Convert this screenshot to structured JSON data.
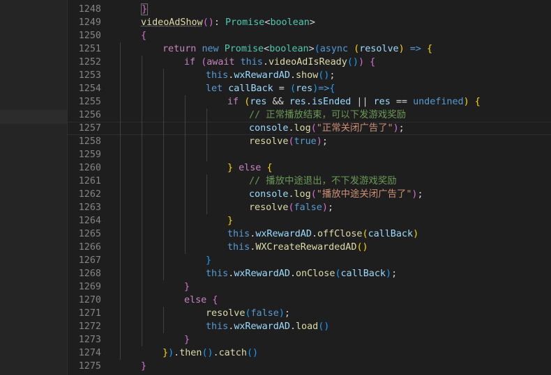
{
  "editor": {
    "language": "javascript",
    "current_line": 1257,
    "lines": [
      {
        "n": "1248",
        "indent": 0,
        "t": [
          [
            "}",
            "p"
          ]
        ],
        "bm": true
      },
      {
        "n": "1249",
        "indent": 0,
        "t": [
          [
            "videoAdShow",
            "f"
          ],
          [
            "()",
            "p"
          ],
          [
            ": ",
            "w"
          ],
          [
            "Promise",
            "t"
          ],
          [
            "<",
            "w"
          ],
          [
            "boolean",
            "t"
          ],
          [
            ">",
            "w"
          ]
        ],
        "fold": true
      },
      {
        "n": "1250",
        "indent": 0,
        "t": [
          [
            "{",
            "p"
          ]
        ]
      },
      {
        "n": "1251",
        "indent": 1,
        "t": [
          [
            "return ",
            "k"
          ],
          [
            "new ",
            "b"
          ],
          [
            "Promise",
            "t"
          ],
          [
            "<",
            "w"
          ],
          [
            "boolean",
            "t"
          ],
          [
            ">",
            "w"
          ],
          [
            "(",
            "q"
          ],
          [
            "async ",
            "b"
          ],
          [
            "(",
            "y"
          ],
          [
            "resolve",
            "v"
          ],
          [
            ")",
            "y"
          ],
          [
            " => ",
            "b"
          ],
          [
            "{",
            "y"
          ]
        ]
      },
      {
        "n": "1252",
        "indent": 2,
        "t": [
          [
            "if ",
            "k"
          ],
          [
            "(",
            "p"
          ],
          [
            "await ",
            "k"
          ],
          [
            "this",
            "b"
          ],
          [
            ".",
            "w"
          ],
          [
            "videoAdIsReady",
            "f"
          ],
          [
            "()",
            "q"
          ],
          [
            ")",
            "p"
          ],
          [
            " ",
            "w"
          ],
          [
            "{",
            "p"
          ]
        ]
      },
      {
        "n": "1253",
        "indent": 3,
        "t": [
          [
            "this",
            "b"
          ],
          [
            ".",
            "w"
          ],
          [
            "wxRewardAD",
            "v"
          ],
          [
            ".",
            "w"
          ],
          [
            "show",
            "f"
          ],
          [
            "()",
            "q"
          ],
          [
            ";",
            "w"
          ]
        ]
      },
      {
        "n": "1254",
        "indent": 3,
        "t": [
          [
            "let ",
            "b"
          ],
          [
            "callBack",
            "v"
          ],
          [
            " = ",
            "w"
          ],
          [
            "(",
            "q"
          ],
          [
            "res",
            "v"
          ],
          [
            ")",
            "q"
          ],
          [
            "=>",
            "b"
          ],
          [
            "{",
            "q"
          ]
        ]
      },
      {
        "n": "1255",
        "indent": 4,
        "t": [
          [
            "if ",
            "k"
          ],
          [
            "(",
            "y"
          ],
          [
            "res",
            "v"
          ],
          [
            " && ",
            "w"
          ],
          [
            "res",
            "v"
          ],
          [
            ".",
            "w"
          ],
          [
            "isEnded",
            "v"
          ],
          [
            " || ",
            "w"
          ],
          [
            "res",
            "v"
          ],
          [
            " == ",
            "w"
          ],
          [
            "undefined",
            "b"
          ],
          [
            ")",
            "y"
          ],
          [
            " ",
            "w"
          ],
          [
            "{",
            "y"
          ]
        ]
      },
      {
        "n": "1256",
        "indent": 5,
        "t": [
          [
            "// 正常播放结束，可以下发游戏奖励",
            "c"
          ]
        ]
      },
      {
        "n": "1257",
        "indent": 5,
        "t": [
          [
            "console",
            "v"
          ],
          [
            ".",
            "w"
          ],
          [
            "log",
            "f"
          ],
          [
            "(",
            "p"
          ],
          [
            "\"正常关闭广告了\"",
            "s"
          ],
          [
            ")",
            "p"
          ],
          [
            ";",
            "w"
          ]
        ]
      },
      {
        "n": "1258",
        "indent": 5,
        "t": [
          [
            "resolve",
            "f"
          ],
          [
            "(",
            "p"
          ],
          [
            "true",
            "b"
          ],
          [
            ")",
            "p"
          ],
          [
            ";",
            "w"
          ]
        ]
      },
      {
        "n": "1259",
        "indent": 5,
        "t": []
      },
      {
        "n": "1260",
        "indent": 4,
        "t": [
          [
            "}",
            "y"
          ],
          [
            " else ",
            "k"
          ],
          [
            "{",
            "y"
          ]
        ]
      },
      {
        "n": "1261",
        "indent": 5,
        "t": [
          [
            "// 播放中途退出，不下发游戏奖励",
            "c"
          ]
        ]
      },
      {
        "n": "1262",
        "indent": 5,
        "t": [
          [
            "console",
            "v"
          ],
          [
            ".",
            "w"
          ],
          [
            "log",
            "f"
          ],
          [
            "(",
            "p"
          ],
          [
            "\"播放中途关闭广告了\"",
            "s"
          ],
          [
            ")",
            "p"
          ],
          [
            ";",
            "w"
          ]
        ]
      },
      {
        "n": "1263",
        "indent": 5,
        "t": [
          [
            "resolve",
            "f"
          ],
          [
            "(",
            "p"
          ],
          [
            "false",
            "b"
          ],
          [
            ")",
            "p"
          ],
          [
            ";",
            "w"
          ]
        ]
      },
      {
        "n": "1264",
        "indent": 4,
        "t": [
          [
            "}",
            "y"
          ]
        ]
      },
      {
        "n": "1265",
        "indent": 4,
        "t": [
          [
            "this",
            "b"
          ],
          [
            ".",
            "w"
          ],
          [
            "wxRewardAD",
            "v"
          ],
          [
            ".",
            "w"
          ],
          [
            "offClose",
            "f"
          ],
          [
            "(",
            "y"
          ],
          [
            "callBack",
            "v"
          ],
          [
            ")",
            "y"
          ]
        ]
      },
      {
        "n": "1266",
        "indent": 4,
        "t": [
          [
            "this",
            "b"
          ],
          [
            ".",
            "w"
          ],
          [
            "WXCreateRewardedAD",
            "f"
          ],
          [
            "()",
            "y"
          ]
        ]
      },
      {
        "n": "1267",
        "indent": 3,
        "t": [
          [
            "}",
            "q"
          ]
        ]
      },
      {
        "n": "1268",
        "indent": 3,
        "t": [
          [
            "this",
            "b"
          ],
          [
            ".",
            "w"
          ],
          [
            "wxRewardAD",
            "v"
          ],
          [
            ".",
            "w"
          ],
          [
            "onClose",
            "f"
          ],
          [
            "(",
            "q"
          ],
          [
            "callBack",
            "v"
          ],
          [
            ")",
            "q"
          ],
          [
            ";",
            "w"
          ]
        ]
      },
      {
        "n": "1269",
        "indent": 2,
        "t": [
          [
            "}",
            "p"
          ]
        ]
      },
      {
        "n": "1270",
        "indent": 2,
        "t": [
          [
            "else ",
            "k"
          ],
          [
            "{",
            "p"
          ]
        ]
      },
      {
        "n": "1271",
        "indent": 3,
        "t": [
          [
            "resolve",
            "f"
          ],
          [
            "(",
            "q"
          ],
          [
            "false",
            "b"
          ],
          [
            ")",
            "q"
          ],
          [
            ";",
            "w"
          ]
        ]
      },
      {
        "n": "1272",
        "indent": 3,
        "t": [
          [
            "this",
            "b"
          ],
          [
            ".",
            "w"
          ],
          [
            "wxRewardAD",
            "v"
          ],
          [
            ".",
            "w"
          ],
          [
            "load",
            "f"
          ],
          [
            "()",
            "q"
          ]
        ]
      },
      {
        "n": "1273",
        "indent": 2,
        "t": [
          [
            "}",
            "p"
          ]
        ]
      },
      {
        "n": "1274",
        "indent": 1,
        "t": [
          [
            "}",
            "y"
          ],
          [
            ")",
            "q"
          ],
          [
            ".",
            "w"
          ],
          [
            "then",
            "f"
          ],
          [
            "()",
            "q"
          ],
          [
            ".",
            "w"
          ],
          [
            "catch",
            "f"
          ],
          [
            "()",
            "q"
          ]
        ]
      },
      {
        "n": "1275",
        "indent": 0,
        "t": [
          [
            "}",
            "p"
          ]
        ]
      }
    ]
  },
  "colors": {
    "background": "#1e1e1e",
    "sidebar": "#252526",
    "line_number": "#858585",
    "keyword": "#c586c0",
    "storage": "#569cd6",
    "type": "#4ec9b0",
    "function": "#dcdcaa",
    "variable": "#9cdcfe",
    "string": "#ce9178",
    "comment": "#6a9955",
    "bracket_gold": "#ffd700",
    "bracket_orchid": "#da70d6",
    "bracket_blue": "#179fff"
  }
}
